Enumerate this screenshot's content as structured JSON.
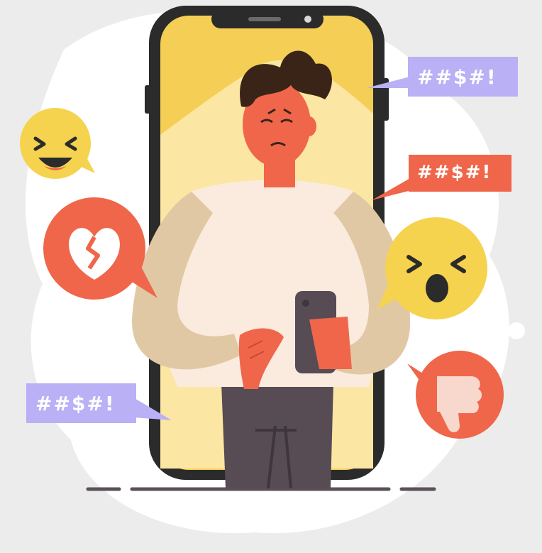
{
  "speech_bubbles": [
    {
      "text": "##$#!",
      "color": "#b9b0f5",
      "text_color": "#ffffff"
    },
    {
      "text": "##$#!",
      "color": "#f0664a",
      "text_color": "#ffffff"
    },
    {
      "text": "##$#!",
      "color": "#b9b0f5",
      "text_color": "#ffffff"
    }
  ],
  "icons": [
    "laughing-emoji-icon",
    "broken-heart-icon",
    "shouting-emoji-icon",
    "thumbs-down-icon"
  ],
  "colors": {
    "background": "#ececec",
    "phone_screen": "#f5cf55",
    "phone_frame": "#2b2b2b",
    "accent_red": "#f0664a",
    "accent_purple": "#b9b0f5",
    "emoji_yellow": "#f6d34e"
  }
}
